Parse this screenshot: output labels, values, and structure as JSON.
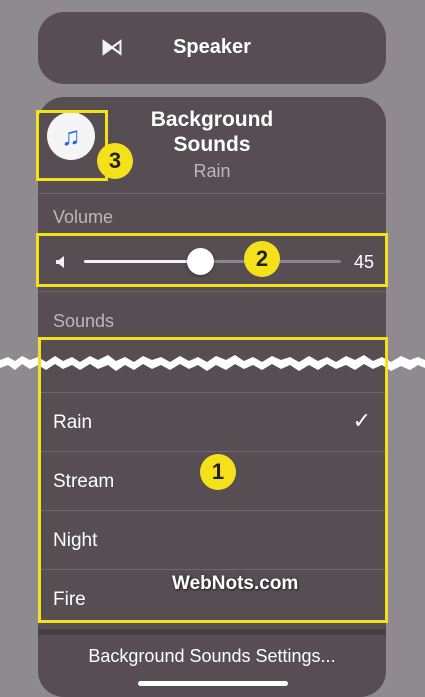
{
  "speaker": {
    "label": "Speaker",
    "icon": "ear-icon"
  },
  "background_sounds": {
    "title": "Background Sounds",
    "subtitle": "Rain",
    "icon": "music-notes-icon",
    "icon_color": "#1f6bdc"
  },
  "volume": {
    "label": "Volume",
    "value": "45",
    "level": 0.45
  },
  "sounds": {
    "label": "Sounds",
    "items": [
      {
        "name": "Rain",
        "selected": true,
        "check": "✓"
      },
      {
        "name": "Stream",
        "selected": false
      },
      {
        "name": "Night",
        "selected": false
      },
      {
        "name": "Fire",
        "selected": false
      }
    ]
  },
  "footer": {
    "settings_label": "Background Sounds Settings..."
  },
  "annotations": {
    "badge_1": "1",
    "badge_2": "2",
    "badge_3": "3",
    "highlight_color": "#f5e11a"
  },
  "watermark": "WebNots.com"
}
